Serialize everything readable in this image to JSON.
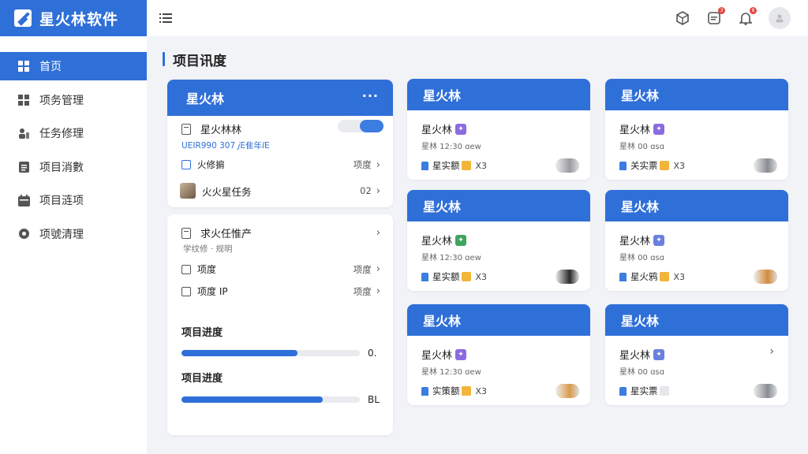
{
  "app": {
    "name": "星火林软件"
  },
  "sidebar": {
    "items": [
      {
        "label": "首页",
        "icon": "grid-icon",
        "active": true
      },
      {
        "label": "项务管理",
        "icon": "grid-icon"
      },
      {
        "label": "任务修理",
        "icon": "people-icon"
      },
      {
        "label": "项目消數",
        "icon": "clipboard-icon"
      },
      {
        "label": "项目涟项",
        "icon": "calendar-icon"
      },
      {
        "label": "项號清理",
        "icon": "settings-icon"
      }
    ]
  },
  "topbar": {
    "notification_badge": "8",
    "message_badge": "3"
  },
  "page": {
    "title": "项目讯度"
  },
  "left_panel": {
    "header": "星火林",
    "more": "···",
    "task1": {
      "title": "星火林林",
      "meta": "UEIR990 307 𝘫E隹年𝘭E",
      "sub": "火修掮",
      "sub_right": "项度",
      "member": "火火星任务",
      "member_right": "02"
    },
    "task2": {
      "title": "求火任惟产",
      "meta": "学纹修 · 规明",
      "item1": "项度",
      "item1_right": "项度",
      "item2": "项度 IP",
      "item2_right": "项度"
    },
    "progress": [
      {
        "label": "项目进度",
        "value_text": "0.",
        "fraction": 0.65
      },
      {
        "label": "项目进度",
        "value_text": "BL",
        "fraction": 0.79
      }
    ]
  },
  "cards": [
    {
      "header": "星火林",
      "title": "星火林",
      "tag_color": "#8b6be0",
      "sub": "星林 12:30 ɑew",
      "foot": "星实额",
      "foot_tag_color": "#f2b53a",
      "count": "X3",
      "avatar_color": "#9a9aa0"
    },
    {
      "header": "星火林",
      "title": "星火林",
      "tag_color": "#8b6be0",
      "sub": "星林 00 ɑsɑ",
      "foot": "关实票",
      "foot_tag_color": "#f2b53a",
      "count": "X3",
      "avatar_color": "#888c92"
    },
    {
      "header": "星火林",
      "title": "星火林",
      "tag_color": "#3fa45c",
      "sub": "星林 12:30 ɑew",
      "foot": "星实额",
      "foot_tag_color": "#f2b53a",
      "count": "X3",
      "avatar_color": "#2a2a2a"
    },
    {
      "header": "星火林",
      "title": "星火林",
      "tag_color": "#6b7fe0",
      "sub": "星林 00 ɑsɑ",
      "foot": "星火鸦",
      "foot_tag_color": "#f2b53a",
      "count": "X3",
      "avatar_color": "#d48a3a"
    },
    {
      "header": "星火林",
      "title": "星火林",
      "tag_color": "#8b6be0",
      "sub": "星林 12:30 ɑew",
      "foot": "实策额",
      "foot_tag_color": "#f2b53a",
      "count": "X3",
      "avatar_color": "#d99a4a"
    },
    {
      "header": "星火林",
      "title": "星火林",
      "tag_color": "#6b7fe0",
      "sub": "星林 00 ɑsɑ",
      "foot": "星实票",
      "foot_tag_color": "#e6e7ea",
      "count": "",
      "avatar_color": "#888c92"
    }
  ],
  "colors": {
    "accent": "#2f6fd8",
    "background": "#f1f3f7"
  }
}
